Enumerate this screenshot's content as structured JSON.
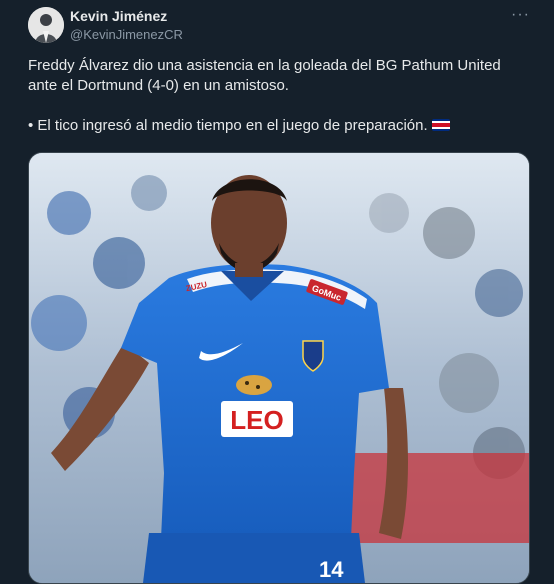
{
  "author": {
    "name": "Kevin Jiménez",
    "handle": "@KevinJimenezCR"
  },
  "more_icon": "more-horizontal-icon",
  "tweet": {
    "line1": "Freddy Álvarez dio una asistencia en la goleada del BG Pathum United ante el Dortmund (4-0) en un amistoso.",
    "line2": "• El tico ingresó al medio tiempo en el juego de preparación.",
    "flag": "costa-rica-flag"
  },
  "media": {
    "sponsor": "LEO",
    "club_badge": "BG Pathum United",
    "sleeve": "GoMuc",
    "sleeve_left": "ZUZU",
    "number": "14",
    "icons": [
      "nike-swoosh-icon",
      "leopard-logo-icon"
    ]
  },
  "colors": {
    "background": "#15202b",
    "jersey": "#1d6fd6",
    "flag_blue": "#002b7f",
    "flag_red": "#ce1126"
  }
}
